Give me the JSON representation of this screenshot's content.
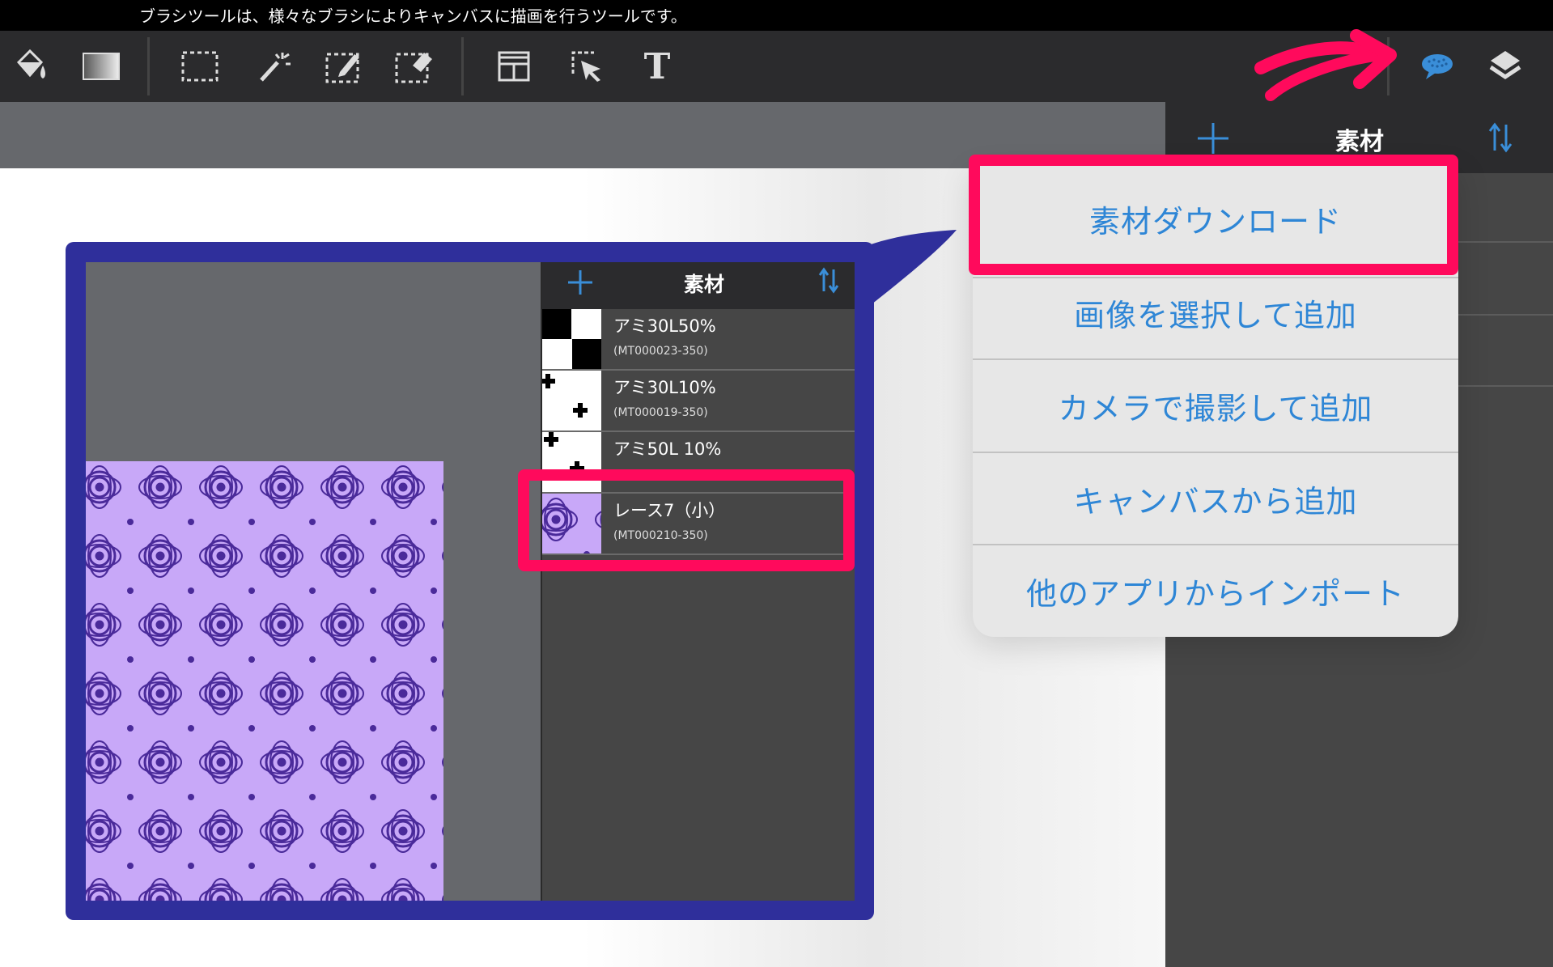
{
  "status_bar": {
    "hint": "ブラシツールは、様々なブラシによりキャンバスに描画を行うツールです。"
  },
  "toolbar": {
    "tools": [
      "paint-bucket-icon",
      "gradient-icon",
      "rect-select-icon",
      "magic-wand-icon",
      "pen-select-icon",
      "eraser-select-icon",
      "layout-icon",
      "move-select-icon",
      "text-icon"
    ],
    "text_tool_glyph": "T",
    "right_icons": [
      "material-bubble-icon",
      "layers-icon"
    ],
    "accent": "#2e86d6"
  },
  "right_panel": {
    "title": "素材",
    "bg": "#464646"
  },
  "menu": {
    "items": [
      "素材ダウンロード",
      "画像を選択して追加",
      "カメラで撮影して追加",
      "キャンバスから追加",
      "他のアプリからインポート"
    ],
    "highlighted_index": 0
  },
  "zoom": {
    "panel_title": "素材",
    "materials": [
      {
        "name": "アミ30L50%",
        "code": "(MT000023-350)",
        "thumb": "checker"
      },
      {
        "name": "アミ30L10%",
        "code": "(MT000019-350)",
        "thumb": "dots"
      },
      {
        "name": "アミ50L 10%",
        "code": "",
        "thumb": "dots"
      },
      {
        "name": "レース7（小）",
        "code": "(MT000210-350)",
        "thumb": "lace"
      }
    ],
    "highlighted_index": 3
  },
  "annotation_color": "#ff0a5c",
  "callout_color": "#2f2f9b",
  "pattern_colors": {
    "light": "#c8a8f8",
    "dark": "#4a2a9a"
  }
}
